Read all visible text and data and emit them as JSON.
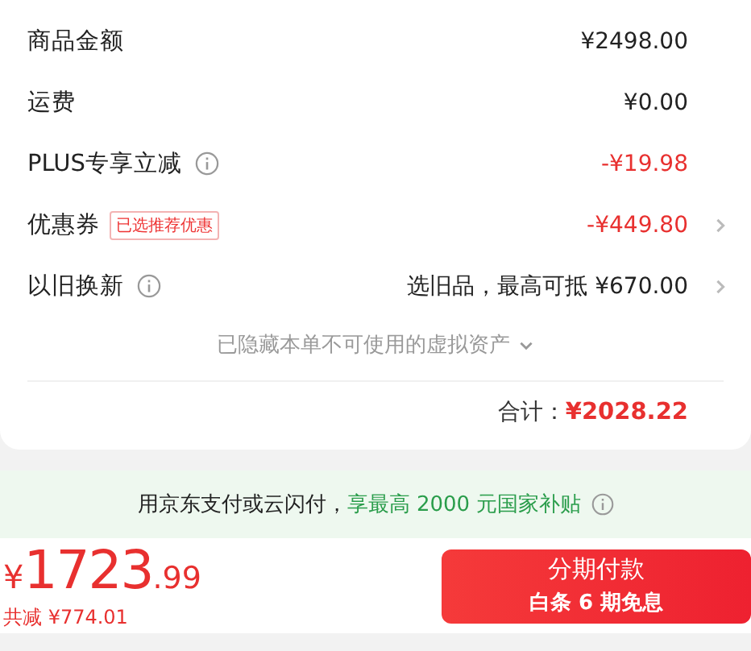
{
  "summary_rows": [
    {
      "label": "商品金额",
      "info": false,
      "value": "¥2498.00",
      "kind": "plain",
      "chevron": false
    },
    {
      "label": "运费",
      "info": false,
      "value": "¥0.00",
      "kind": "plain",
      "chevron": false
    },
    {
      "label": "PLUS专享立减",
      "info": true,
      "value": "-¥19.98",
      "kind": "deduction",
      "chevron": false
    },
    {
      "label": "优惠券",
      "info": false,
      "tag": "已选推荐优惠",
      "value": "-¥449.80",
      "kind": "deduction",
      "chevron": true
    },
    {
      "label": "以旧换新",
      "info": true,
      "value": "选旧品，最高可抵 ¥670.00",
      "kind": "plain",
      "chevron": true
    }
  ],
  "hidden_notice": {
    "text": "已隐藏本单不可使用的虚拟资产",
    "expanded": false
  },
  "total": {
    "label": "合计：",
    "value": "¥2028.22"
  },
  "subsidy_banner": {
    "text": "用京东支付或云闪付，",
    "highlight": "享最高 2000 元国家补贴"
  },
  "checkout": {
    "currency": "¥",
    "price_integer": "1723",
    "price_decimal": ".99",
    "savings": "共减 ¥774.01",
    "button_title": "分期付款",
    "button_subtitle": "白条 6 期免息"
  }
}
